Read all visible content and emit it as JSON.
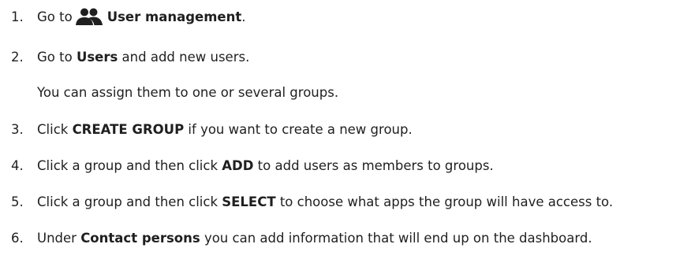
{
  "steps": [
    {
      "number": "1.",
      "pre": "Go to",
      "icon": "users-icon",
      "bold": "User management",
      "post": "."
    },
    {
      "number": "2.",
      "pre": "Go to ",
      "bold": "Users",
      "post": " and add new users.",
      "note": "You can assign them to one or several groups."
    },
    {
      "number": "3.",
      "pre": "Click ",
      "bold": "CREATE GROUP",
      "post": " if you want to create a new group."
    },
    {
      "number": "4.",
      "pre": "Click a group and then click ",
      "bold": "ADD",
      "post": " to add users as members to groups."
    },
    {
      "number": "5.",
      "pre": "Click a group and then click ",
      "bold": "SELECT",
      "post": " to choose what apps the group will have access to."
    },
    {
      "number": "6.",
      "pre": "Under ",
      "bold": "Contact persons",
      "post": " you can add information that will end up on the dashboard."
    }
  ],
  "colors": {
    "text": "#1f1f1f",
    "background": "#ffffff"
  }
}
